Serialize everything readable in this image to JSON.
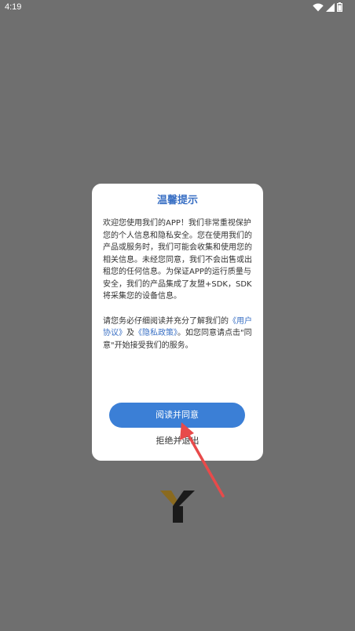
{
  "status_bar": {
    "time": "4:19",
    "icons": [
      "wifi-icon",
      "signal-icon",
      "battery-icon"
    ]
  },
  "dialog": {
    "title": "温馨提示",
    "body": {
      "p1": "欢迎您使用我们的APP！我们非常重视保护您的个人信息和隐私安全。您在使用我们的产品或服务时，我们可能会收集和使用您的相关信息。未经您同意，我们不会出售或出租您的任何信息。为保证APP的运行质量与安全，我们的产品集成了友盟+SDK，SDK将采集您的设备信息。",
      "p2_before": "请您务必仔细阅读并充分了解我们的",
      "user_agreement_link": "《用户协议》",
      "and": "及",
      "privacy_policy_link": "《隐私政策》",
      "p2_after": "。如您同意请点击\"同意\"开始接受我们的服务。"
    },
    "agree_button": "阅读并同意",
    "exit_link": "拒绝并退出"
  },
  "colors": {
    "background": "#6f6f6f",
    "accent": "#3a70c4",
    "button": "#3b7fd6",
    "annotation_arrow": "#e84a4a",
    "logo_gold": "#8a6a1f",
    "logo_black": "#1a1a1a"
  },
  "logo": {
    "icon": "app-logo-y-icon"
  }
}
